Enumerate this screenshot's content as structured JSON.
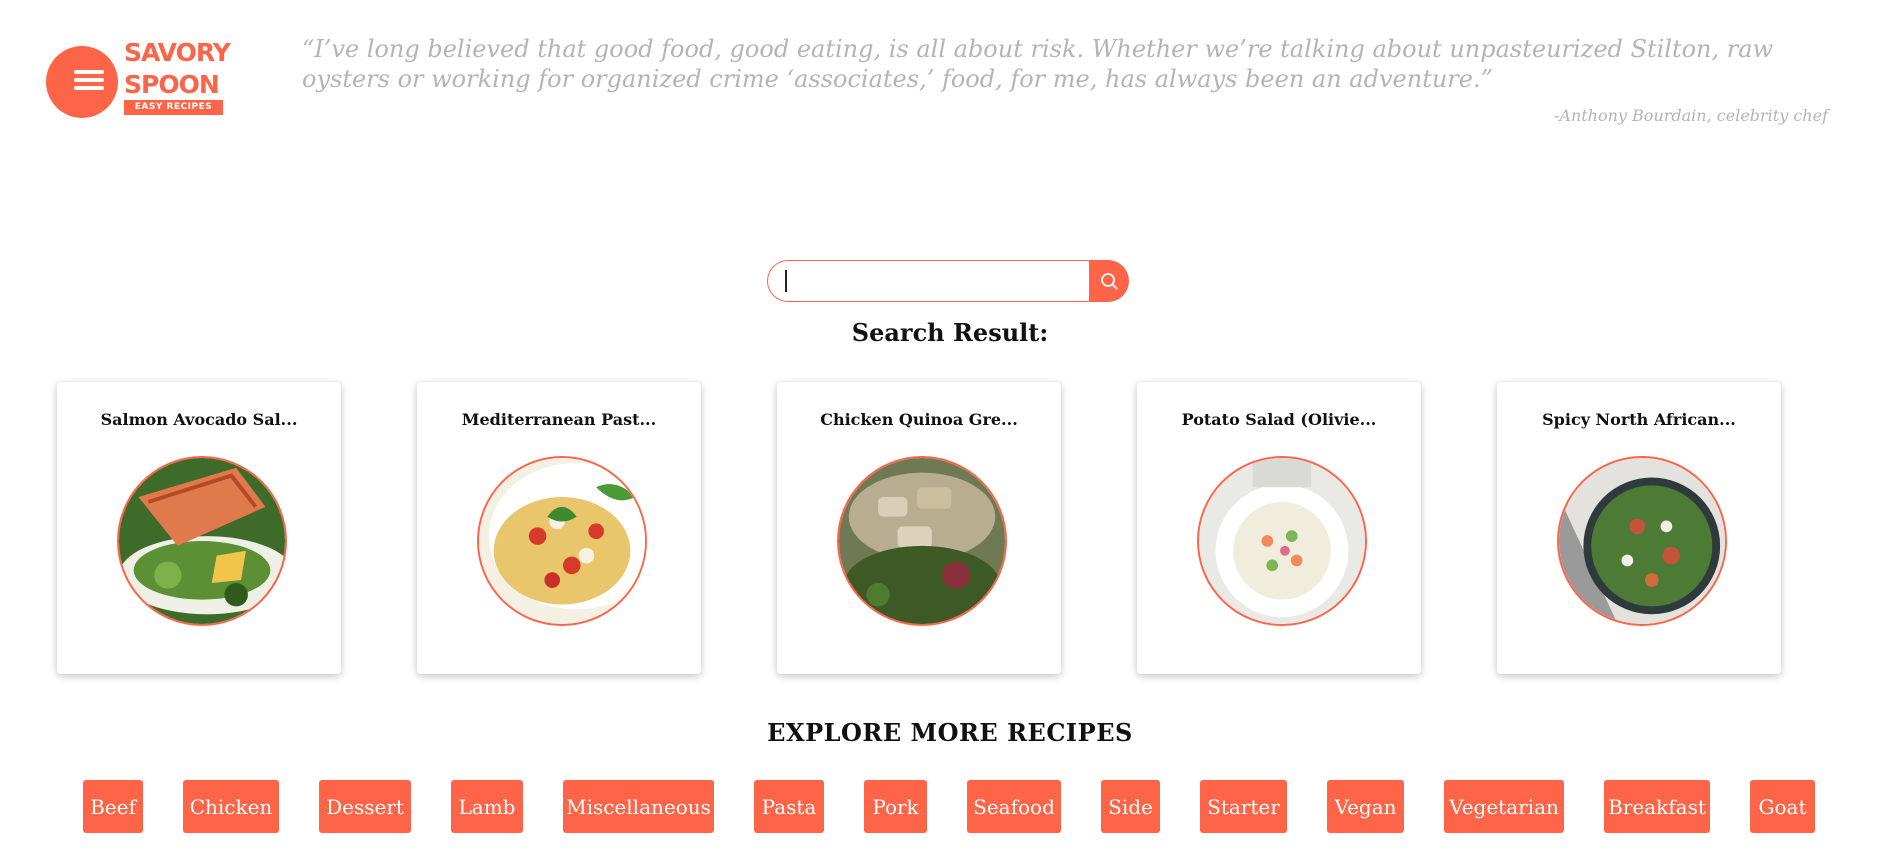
{
  "brand": {
    "name_line1": "SAVORY",
    "name_line2": "SPOON",
    "tagline": "EASY RECIPES",
    "accent_color": "#fe6448"
  },
  "quote": {
    "text": "“I’ve long believed that good food, good eating, is all about risk. Whether we’re talking about unpasteurized Stilton, raw oysters or working for organized crime ‘associates,’ food, for me, has always been an adventure.”",
    "author": "-Anthony Bourdain, celebrity chef"
  },
  "search": {
    "value": "",
    "placeholder": "",
    "button_icon": "search-icon"
  },
  "results": {
    "heading": "Search Result:",
    "items": [
      {
        "title": "Salmon Avocado Sal..."
      },
      {
        "title": "Mediterranean Past..."
      },
      {
        "title": "Chicken Quinoa Gre..."
      },
      {
        "title": "Potato Salad (Olivie..."
      },
      {
        "title": "Spicy North African..."
      }
    ]
  },
  "explore": {
    "heading": "EXPLORE MORE RECIPES",
    "categories": [
      "Beef",
      "Chicken",
      "Dessert",
      "Lamb",
      "Miscellaneous",
      "Pasta",
      "Pork",
      "Seafood",
      "Side",
      "Starter",
      "Vegan",
      "Vegetarian",
      "Breakfast",
      "Goat"
    ]
  }
}
